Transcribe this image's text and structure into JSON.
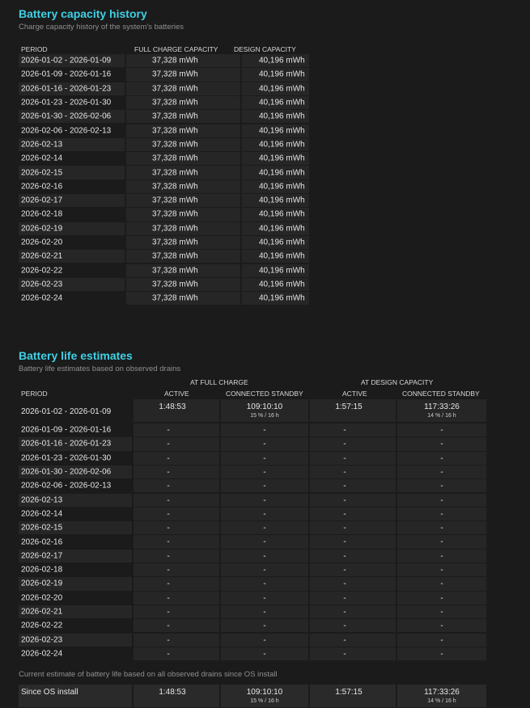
{
  "capacity": {
    "title": "Battery capacity history",
    "subtitle": "Charge capacity history of the system's batteries",
    "headers": {
      "period": "PERIOD",
      "full": "FULL CHARGE CAPACITY",
      "design": "DESIGN CAPACITY"
    },
    "rows": [
      {
        "period": "2026-01-02 - 2026-01-09",
        "full": "37,328 mWh",
        "design": "40,196 mWh"
      },
      {
        "period": "2026-01-09 - 2026-01-16",
        "full": "37,328 mWh",
        "design": "40,196 mWh"
      },
      {
        "period": "2026-01-16 - 2026-01-23",
        "full": "37,328 mWh",
        "design": "40,196 mWh"
      },
      {
        "period": "2026-01-23 - 2026-01-30",
        "full": "37,328 mWh",
        "design": "40,196 mWh"
      },
      {
        "period": "2026-01-30 - 2026-02-06",
        "full": "37,328 mWh",
        "design": "40,196 mWh"
      },
      {
        "period": "2026-02-06 - 2026-02-13",
        "full": "37,328 mWh",
        "design": "40,196 mWh"
      },
      {
        "period": "2026-02-13",
        "full": "37,328 mWh",
        "design": "40,196 mWh"
      },
      {
        "period": "2026-02-14",
        "full": "37,328 mWh",
        "design": "40,196 mWh"
      },
      {
        "period": "2026-02-15",
        "full": "37,328 mWh",
        "design": "40,196 mWh"
      },
      {
        "period": "2026-02-16",
        "full": "37,328 mWh",
        "design": "40,196 mWh"
      },
      {
        "period": "2026-02-17",
        "full": "37,328 mWh",
        "design": "40,196 mWh"
      },
      {
        "period": "2026-02-18",
        "full": "37,328 mWh",
        "design": "40,196 mWh"
      },
      {
        "period": "2026-02-19",
        "full": "37,328 mWh",
        "design": "40,196 mWh"
      },
      {
        "period": "2026-02-20",
        "full": "37,328 mWh",
        "design": "40,196 mWh"
      },
      {
        "period": "2026-02-21",
        "full": "37,328 mWh",
        "design": "40,196 mWh"
      },
      {
        "period": "2026-02-22",
        "full": "37,328 mWh",
        "design": "40,196 mWh"
      },
      {
        "period": "2026-02-23",
        "full": "37,328 mWh",
        "design": "40,196 mWh"
      },
      {
        "period": "2026-02-24",
        "full": "37,328 mWh",
        "design": "40,196 mWh"
      }
    ]
  },
  "estimates": {
    "title": "Battery life estimates",
    "subtitle": "Battery life estimates based on observed drains",
    "group_full": "AT FULL CHARGE",
    "group_design": "AT DESIGN CAPACITY",
    "headers": {
      "period": "PERIOD",
      "active": "ACTIVE",
      "standby": "CONNECTED STANDBY",
      "active2": "ACTIVE",
      "standby2": "CONNECTED STANDBY"
    },
    "first_row": {
      "period": "2026-01-02 - 2026-01-09",
      "active": "1:48:53",
      "standby": "109:10:10",
      "standby_note": "15 % / 16 h",
      "active2": "1:57:15",
      "standby2": "117:33:26",
      "standby2_note": "14 % / 16 h"
    },
    "rows": [
      {
        "period": "2026-01-09 - 2026-01-16",
        "a": "-",
        "b": "-",
        "c": "-",
        "d": "-"
      },
      {
        "period": "2026-01-16 - 2026-01-23",
        "a": "-",
        "b": "-",
        "c": "-",
        "d": "-"
      },
      {
        "period": "2026-01-23 - 2026-01-30",
        "a": "-",
        "b": "-",
        "c": "-",
        "d": "-"
      },
      {
        "period": "2026-01-30 - 2026-02-06",
        "a": "-",
        "b": "-",
        "c": "-",
        "d": "-"
      },
      {
        "period": "2026-02-06 - 2026-02-13",
        "a": "-",
        "b": "-",
        "c": "-",
        "d": "-"
      },
      {
        "period": "2026-02-13",
        "a": "-",
        "b": "-",
        "c": "-",
        "d": "-"
      },
      {
        "period": "2026-02-14",
        "a": "-",
        "b": "-",
        "c": "-",
        "d": "-"
      },
      {
        "period": "2026-02-15",
        "a": "-",
        "b": "-",
        "c": "-",
        "d": "-"
      },
      {
        "period": "2026-02-16",
        "a": "-",
        "b": "-",
        "c": "-",
        "d": "-"
      },
      {
        "period": "2026-02-17",
        "a": "-",
        "b": "-",
        "c": "-",
        "d": "-"
      },
      {
        "period": "2026-02-18",
        "a": "-",
        "b": "-",
        "c": "-",
        "d": "-"
      },
      {
        "period": "2026-02-19",
        "a": "-",
        "b": "-",
        "c": "-",
        "d": "-"
      },
      {
        "period": "2026-02-20",
        "a": "-",
        "b": "-",
        "c": "-",
        "d": "-"
      },
      {
        "period": "2026-02-21",
        "a": "-",
        "b": "-",
        "c": "-",
        "d": "-"
      },
      {
        "period": "2026-02-22",
        "a": "-",
        "b": "-",
        "c": "-",
        "d": "-"
      },
      {
        "period": "2026-02-23",
        "a": "-",
        "b": "-",
        "c": "-",
        "d": "-"
      },
      {
        "period": "2026-02-24",
        "a": "-",
        "b": "-",
        "c": "-",
        "d": "-"
      }
    ],
    "since_caption": "Current estimate of battery life based on all observed drains since OS install",
    "since_row": {
      "period": "Since OS install",
      "active": "1:48:53",
      "standby": "109:10:10",
      "standby_note": "15 % / 16 h",
      "active2": "1:57:15",
      "standby2": "117:33:26",
      "standby2_note": "14 % / 16 h"
    }
  }
}
